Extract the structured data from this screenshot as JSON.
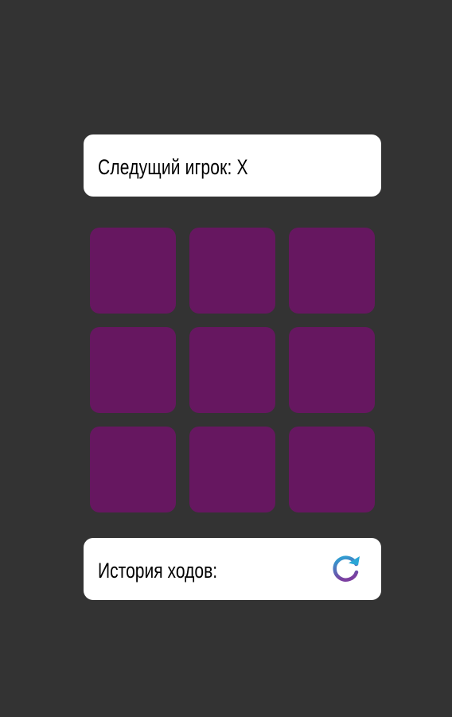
{
  "status": {
    "label": "Следущий игрок: X"
  },
  "board": {
    "cells": [
      "",
      "",
      "",
      "",
      "",
      "",
      "",
      "",
      ""
    ],
    "cell_color": "#661760"
  },
  "history": {
    "label": "История ходов:",
    "restart_icon": "restart-icon",
    "icon_gradient": [
      "#2aa6d6",
      "#7b3fa0"
    ]
  },
  "colors": {
    "background": "#333333",
    "panel": "#ffffff"
  }
}
